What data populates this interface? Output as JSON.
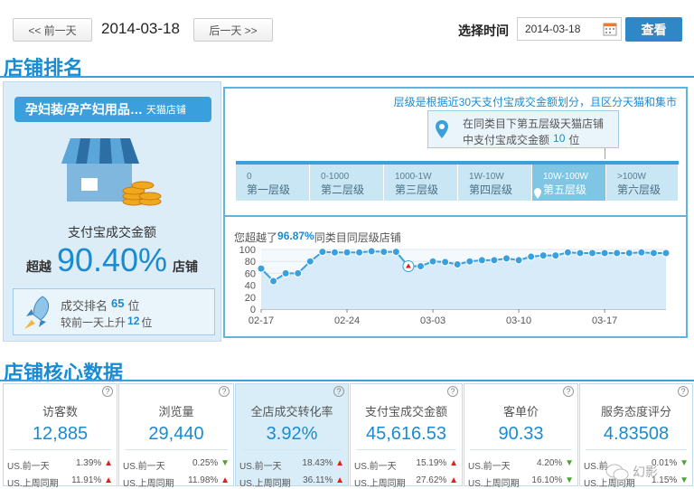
{
  "topbar": {
    "prev_day": "<< 前一天",
    "current_date": "2014-03-18",
    "next_day": "后一天 >>",
    "select_time_label": "选择时间",
    "date_input_value": "2014-03-18",
    "view_button": "查看"
  },
  "ranking": {
    "section_title": "店铺排名",
    "shop_category": "孕妇装/孕产妇用品…",
    "shop_type": "天猫店铺",
    "metric_label": "支付宝成交金额",
    "exceed_prefix": "超越",
    "exceed_value": "90.40%",
    "exceed_suffix": "店铺",
    "rank_label": "成交排名",
    "rank_value": "65",
    "rank_unit": "位",
    "change_prefix": "较前一天上升",
    "change_value": "12",
    "change_unit": "位",
    "tier_note": "层级是根据近30天支付宝成交金额划分，且区分天猫和集市",
    "tooltip_line1": "在同类目下第五层级天猫店铺",
    "tooltip_line2_prefix": "中支付宝成交金额",
    "tooltip_line2_value": "10",
    "tooltip_line2_suffix": "位",
    "tiers": [
      {
        "range": "0",
        "name": "第一层级"
      },
      {
        "range": "0-1000",
        "name": "第二层级"
      },
      {
        "range": "1000-1W",
        "name": "第三层级"
      },
      {
        "range": "1W-10W",
        "name": "第四层级"
      },
      {
        "range": "10W-100W",
        "name": "第五层级"
      },
      {
        "range": ">100W",
        "name": "第六层级"
      }
    ],
    "active_tier": 4,
    "chart_caption_prefix": "您超越了",
    "chart_caption_value": "96.87%",
    "chart_caption_suffix": "同类目同层级店铺"
  },
  "chart_data": {
    "type": "area",
    "x_ticks": [
      "02-17",
      "02-24",
      "03-03",
      "03-10",
      "03-17"
    ],
    "y_ticks": [
      "0",
      "20",
      "40",
      "60",
      "80",
      "100"
    ],
    "ylim": [
      0,
      100
    ],
    "values": [
      68,
      47,
      60,
      60,
      80,
      96,
      95,
      95,
      95,
      97,
      96,
      96,
      72,
      72,
      80,
      79,
      75,
      80,
      82,
      82,
      85,
      82,
      88,
      90,
      90,
      95,
      94,
      94,
      94,
      94,
      94,
      95,
      94,
      94
    ],
    "grid": true
  },
  "core": {
    "section_title": "店铺核心数据",
    "cards": [
      {
        "title": "访客数",
        "value": "12,885",
        "r1_label": "US.前一天",
        "r1_value": "1.39%",
        "r1_dir": "up",
        "r2_label": "US.上周同期",
        "r2_value": "11.91%",
        "r2_dir": "up"
      },
      {
        "title": "浏览量",
        "value": "29,440",
        "r1_label": "US.前一天",
        "r1_value": "0.25%",
        "r1_dir": "dn",
        "r2_label": "US.上周同期",
        "r2_value": "11.98%",
        "r2_dir": "up"
      },
      {
        "title": "全店成交转化率",
        "value": "3.92%",
        "r1_label": "US.前一天",
        "r1_value": "18.43%",
        "r1_dir": "up",
        "r2_label": "US.上周同期",
        "r2_value": "36.11%",
        "r2_dir": "up"
      },
      {
        "title": "支付宝成交金额",
        "value": "45,616.53",
        "r1_label": "US.前一天",
        "r1_value": "15.19%",
        "r1_dir": "up",
        "r2_label": "US.上周同期",
        "r2_value": "27.62%",
        "r2_dir": "up"
      },
      {
        "title": "客单价",
        "value": "90.33",
        "r1_label": "US.前一天",
        "r1_value": "4.20%",
        "r1_dir": "dn",
        "r2_label": "US.上周同期",
        "r2_value": "16.10%",
        "r2_dir": "dn"
      },
      {
        "title": "服务态度评分",
        "value": "4.83508",
        "r1_label": "US.前",
        "r1_value": "0.01%",
        "r1_dir": "dn",
        "r2_label": "US.上周同期",
        "r2_value": "1.15%",
        "r2_dir": "dn"
      }
    ]
  },
  "watermark": "幻影"
}
